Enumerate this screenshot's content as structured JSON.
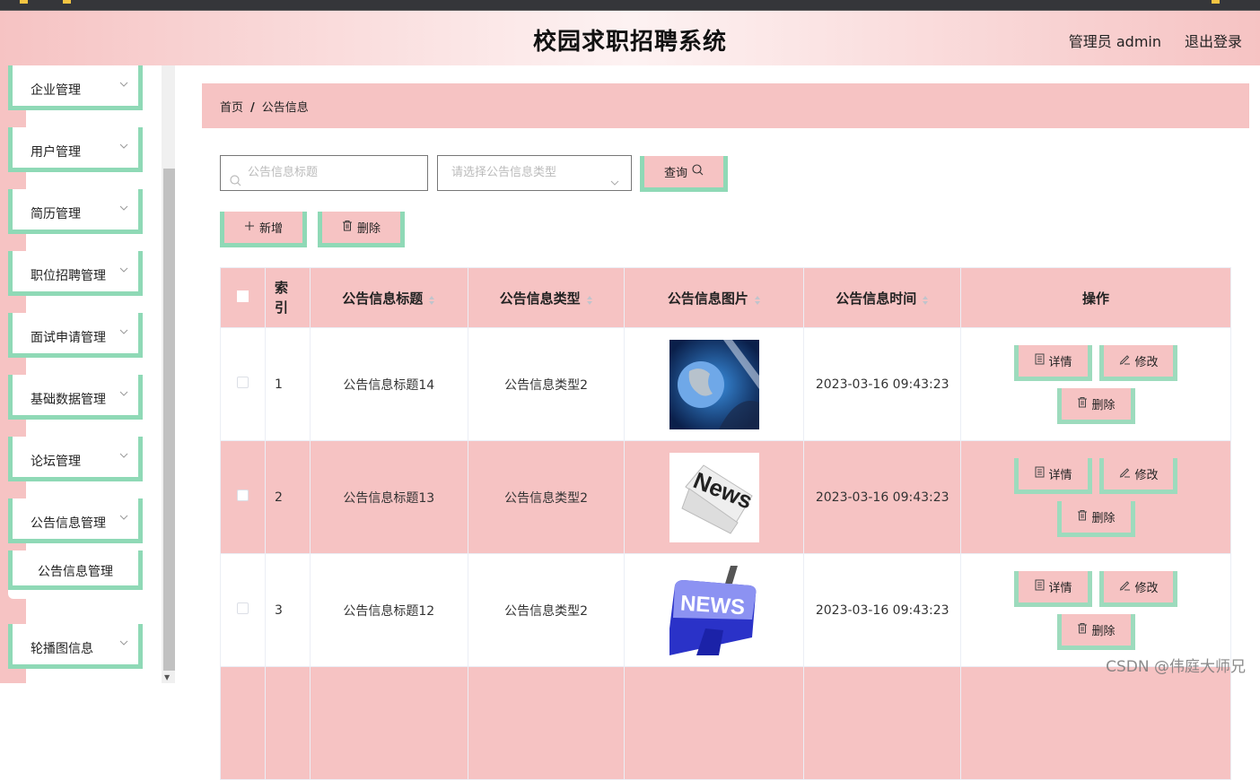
{
  "header": {
    "title": "校园求职招聘系统",
    "user_label": "管理员 admin",
    "logout_label": "退出登录"
  },
  "sidebar": {
    "items": [
      {
        "label": "企业管理"
      },
      {
        "label": "用户管理"
      },
      {
        "label": "简历管理"
      },
      {
        "label": "职位招聘管理"
      },
      {
        "label": "面试申请管理"
      },
      {
        "label": "基础数据管理"
      },
      {
        "label": "论坛管理"
      },
      {
        "label": "公告信息管理",
        "expanded": true,
        "children": [
          {
            "label": "公告信息管理"
          }
        ]
      },
      {
        "label": "轮播图信息"
      }
    ]
  },
  "breadcrumb": {
    "home": "首页",
    "separator": "/",
    "current": "公告信息"
  },
  "search": {
    "title_placeholder": "公告信息标题",
    "type_placeholder": "请选择公告信息类型",
    "query_label": "查询"
  },
  "actions": {
    "add_label": "新增",
    "delete_label": "删除"
  },
  "table": {
    "columns": [
      "索引",
      "公告信息标题",
      "公告信息类型",
      "公告信息图片",
      "公告信息时间",
      "操作"
    ],
    "rows": [
      {
        "index": "1",
        "title": "公告信息标题14",
        "type": "公告信息类型2",
        "image": "globe-news-image",
        "time": "2023-03-16 09:43:23"
      },
      {
        "index": "2",
        "title": "公告信息标题13",
        "type": "公告信息类型2",
        "image": "newspaper-news-image",
        "time": "2023-03-16 09:43:23"
      },
      {
        "index": "3",
        "title": "公告信息标题12",
        "type": "公告信息类型2",
        "image": "keyboard-news-image",
        "time": "2023-03-16 09:43:23"
      }
    ],
    "row_actions": {
      "detail": "详情",
      "edit": "修改",
      "delete": "删除"
    }
  },
  "watermark": "CSDN @伟庭大师兄",
  "colors": {
    "accent_pink": "#f6c3c3",
    "accent_green": "#8fd9b6"
  }
}
